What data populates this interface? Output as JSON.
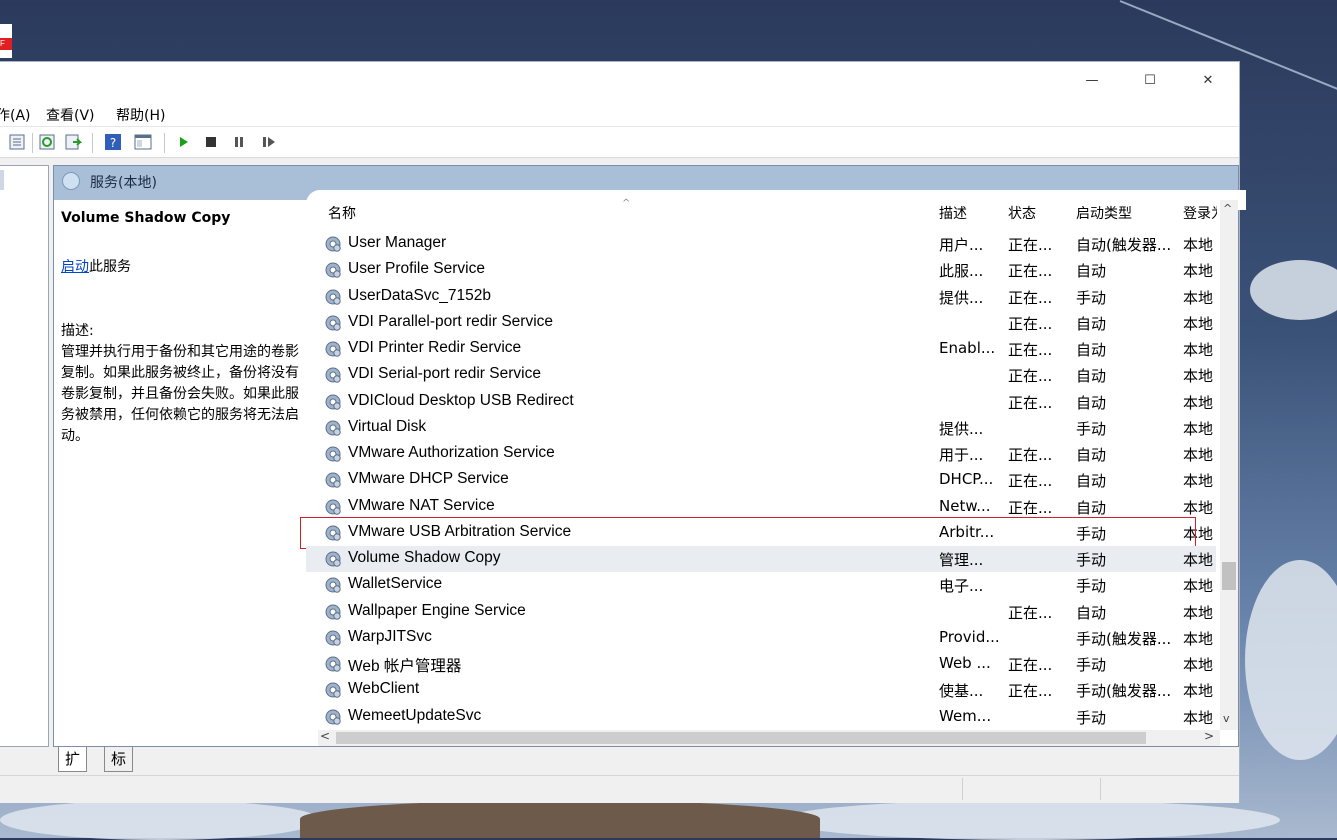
{
  "window": {
    "controls": {
      "minimize": "—",
      "maximize": "☐",
      "close": "✕"
    }
  },
  "menu": {
    "items": [
      "作(A)",
      "查看(V)",
      "帮助(H)"
    ]
  },
  "pane_header": {
    "title": "服务(本地)"
  },
  "description_panel": {
    "service_title": "Volume Shadow Copy",
    "start_link": "启动",
    "start_suffix": "此服务",
    "desc_label": "描述:",
    "desc_text": "管理并执行用于备份和其它用途的卷影复制。如果此服务被终止，备份将没有卷影复制，并且备份会失败。如果此服务被禁用，任何依赖它的服务将无法启动。"
  },
  "columns": {
    "name": "名称",
    "desc": "描述",
    "status": "状态",
    "startup": "启动类型",
    "logon": "登录为"
  },
  "services": [
    {
      "name": "User Manager",
      "desc": "用户...",
      "status": "正在...",
      "startup": "自动(触发器...",
      "logon": "本地"
    },
    {
      "name": "User Profile Service",
      "desc": "此服...",
      "status": "正在...",
      "startup": "自动",
      "logon": "本地"
    },
    {
      "name": "UserDataSvc_7152b",
      "desc": "提供...",
      "status": "正在...",
      "startup": "手动",
      "logon": "本地"
    },
    {
      "name": "VDI Parallel-port redir Service",
      "desc": "",
      "status": "正在...",
      "startup": "自动",
      "logon": "本地"
    },
    {
      "name": "VDI Printer Redir Service",
      "desc": "Enabl...",
      "status": "正在...",
      "startup": "自动",
      "logon": "本地"
    },
    {
      "name": "VDI Serial-port redir Service",
      "desc": "",
      "status": "正在...",
      "startup": "自动",
      "logon": "本地"
    },
    {
      "name": "VDICloud Desktop USB Redirect",
      "desc": "",
      "status": "正在...",
      "startup": "自动",
      "logon": "本地"
    },
    {
      "name": "Virtual Disk",
      "desc": "提供...",
      "status": "",
      "startup": "手动",
      "logon": "本地"
    },
    {
      "name": "VMware Authorization Service",
      "desc": "用于...",
      "status": "正在...",
      "startup": "自动",
      "logon": "本地"
    },
    {
      "name": "VMware DHCP Service",
      "desc": "DHCP...",
      "status": "正在...",
      "startup": "自动",
      "logon": "本地"
    },
    {
      "name": "VMware NAT Service",
      "desc": "Netw...",
      "status": "正在...",
      "startup": "自动",
      "logon": "本地"
    },
    {
      "name": "VMware USB Arbitration Service",
      "desc": "Arbitr...",
      "status": "",
      "startup": "手动",
      "logon": "本地"
    },
    {
      "name": "Volume Shadow Copy",
      "desc": "管理...",
      "status": "",
      "startup": "手动",
      "logon": "本地"
    },
    {
      "name": "WalletService",
      "desc": "电子...",
      "status": "",
      "startup": "手动",
      "logon": "本地"
    },
    {
      "name": "Wallpaper Engine Service",
      "desc": "",
      "status": "正在...",
      "startup": "自动",
      "logon": "本地"
    },
    {
      "name": "WarpJITSvc",
      "desc": "Provid...",
      "status": "",
      "startup": "手动(触发器...",
      "logon": "本地"
    },
    {
      "name": "Web 帐户管理器",
      "desc": "Web ...",
      "status": "正在...",
      "startup": "手动",
      "logon": "本地"
    },
    {
      "name": "WebClient",
      "desc": "使基...",
      "status": "正在...",
      "startup": "手动(触发器...",
      "logon": "本地"
    },
    {
      "name": "WemeetUpdateSvc",
      "desc": "Wem...",
      "status": "",
      "startup": "手动",
      "logon": "本地"
    }
  ],
  "selected_index": 12,
  "highlighted_index": 11,
  "tabs": [
    "扩展",
    "标准"
  ],
  "colors": {
    "header": "#a9bfd8",
    "highlight_border": "#d0202a",
    "link": "#0044cc"
  },
  "icons": [
    "gear-icon"
  ]
}
